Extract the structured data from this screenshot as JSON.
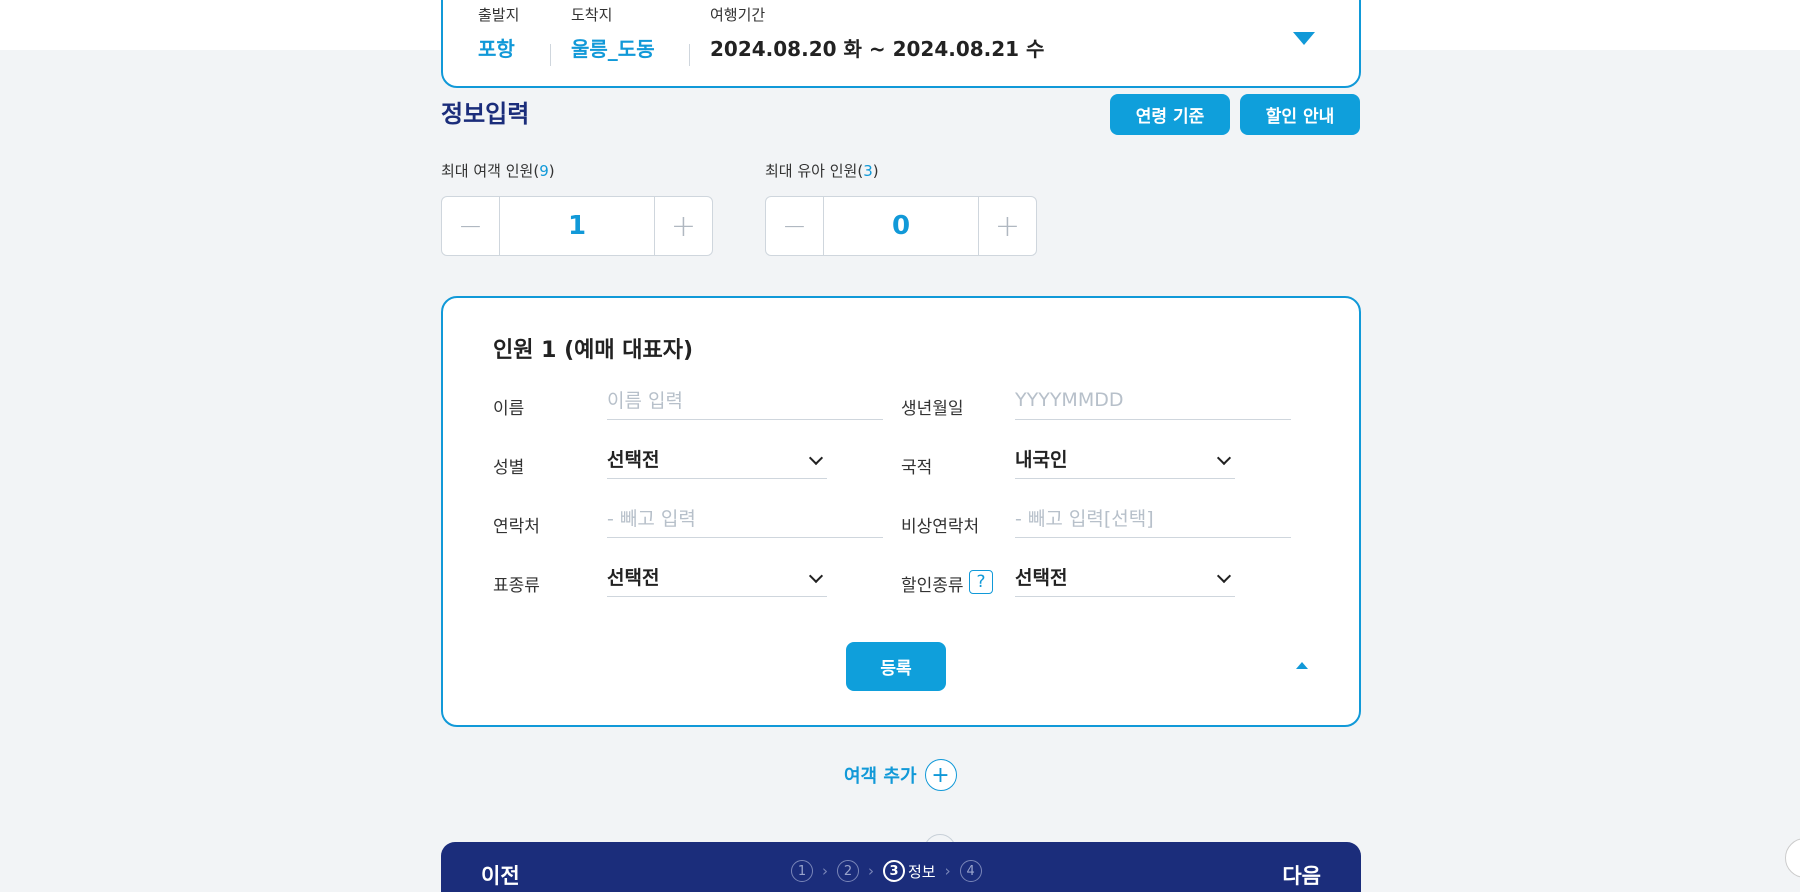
{
  "trip": {
    "departure_label": "출발지",
    "departure_value": "포항",
    "arrival_label": "도착지",
    "arrival_value": "울릉_도동",
    "period_label": "여행기간",
    "period_value": "2024.08.20 화 ~ 2024.08.21 수",
    "toggle_icon": "caret-down-icon"
  },
  "section": {
    "title": "정보입력",
    "age_button": "연령 기준",
    "discount_button": "할인 안내"
  },
  "counters": {
    "adult": {
      "label_prefix": "최대 여객 인원(",
      "max": "9",
      "label_suffix": ")",
      "value": "1",
      "minus": "−",
      "plus": "+"
    },
    "infant": {
      "label_prefix": "최대 유아 인원(",
      "max": "3",
      "label_suffix": ")",
      "value": "0",
      "minus": "−",
      "plus": "+"
    }
  },
  "passenger": {
    "title": "인원 1 (예매 대표자)",
    "name_label": "이름",
    "name_placeholder": "이름 입력",
    "birth_label": "생년월일",
    "birth_placeholder": "YYYYMMDD",
    "gender_label": "성별",
    "gender_value": "선택전",
    "nationality_label": "국적",
    "nationality_value": "내국인",
    "contact_label": "연락처",
    "contact_placeholder": "- 빼고 입력",
    "emergency_label": "비상연락처",
    "emergency_placeholder": "- 빼고 입력[선택]",
    "ticket_label": "표종류",
    "ticket_value": "선택전",
    "discount_label": "할인종류",
    "discount_help": "?",
    "discount_value": "선택전",
    "register_button": "등록"
  },
  "add_passenger": {
    "label": "여객 추가",
    "icon": "+"
  },
  "bottom_nav": {
    "prev": "이전",
    "next": "다음",
    "steps": [
      "1",
      "2",
      "3",
      "4"
    ],
    "active_step_name": "정보",
    "arrow": "›"
  },
  "colors": {
    "accent": "#1199d8",
    "navy": "#1b2d7b",
    "background": "#f2f4f6"
  }
}
